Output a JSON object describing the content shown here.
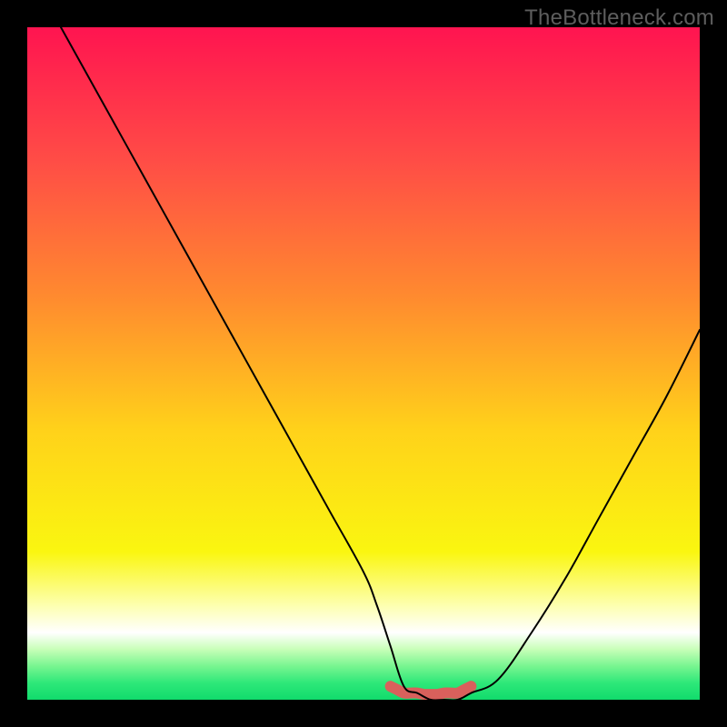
{
  "watermark": "TheBottleneck.com",
  "chart_data": {
    "type": "line",
    "title": "",
    "xlabel": "",
    "ylabel": "",
    "xlim": [
      0,
      100
    ],
    "ylim": [
      0,
      100
    ],
    "series": [
      {
        "name": "curve",
        "x": [
          5,
          10,
          15,
          20,
          25,
          30,
          35,
          40,
          45,
          50,
          52,
          54,
          56,
          58,
          60,
          62,
          64,
          66,
          70,
          75,
          80,
          85,
          90,
          95,
          100
        ],
        "y": [
          100,
          91,
          82,
          73,
          64,
          55,
          46,
          37,
          28,
          19,
          14,
          8,
          2,
          1,
          0,
          0,
          0,
          1,
          3,
          10,
          18,
          27,
          36,
          45,
          55
        ]
      },
      {
        "name": "highlight",
        "x": [
          54,
          55,
          56,
          57,
          58,
          59,
          60,
          61,
          62,
          63,
          64,
          65,
          66
        ],
        "y": [
          2,
          1.5,
          1,
          1,
          1,
          0.8,
          0.8,
          0.8,
          1,
          1,
          1,
          1.5,
          2
        ]
      }
    ],
    "background": {
      "type": "vertical-gradient",
      "stops": [
        {
          "pos": 0.0,
          "color": "#ff1450"
        },
        {
          "pos": 0.2,
          "color": "#ff4d46"
        },
        {
          "pos": 0.4,
          "color": "#ff8a2f"
        },
        {
          "pos": 0.6,
          "color": "#ffd21a"
        },
        {
          "pos": 0.78,
          "color": "#faf610"
        },
        {
          "pos": 0.86,
          "color": "#fdffb0"
        },
        {
          "pos": 0.9,
          "color": "#ffffff"
        },
        {
          "pos": 0.925,
          "color": "#c8ffb8"
        },
        {
          "pos": 0.95,
          "color": "#78f590"
        },
        {
          "pos": 0.975,
          "color": "#2ee879"
        },
        {
          "pos": 1.0,
          "color": "#11db6c"
        }
      ]
    },
    "highlight_style": {
      "stroke": "#d9605c",
      "stroke_width": 12,
      "cap": "round"
    },
    "curve_style": {
      "stroke": "#000000",
      "stroke_width": 2
    }
  }
}
